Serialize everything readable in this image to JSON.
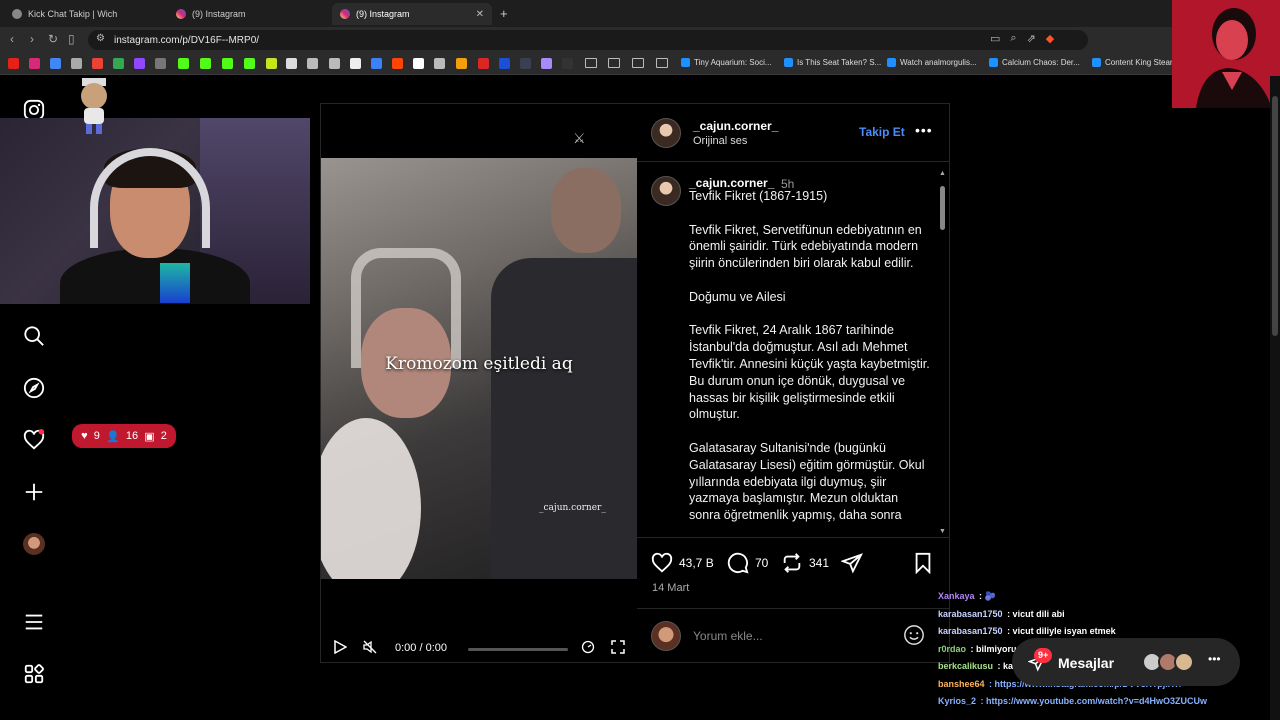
{
  "browser": {
    "tabs": [
      {
        "title": "Kick Chat Takip | Wich"
      },
      {
        "title": "(9) Instagram"
      },
      {
        "title": "(9) Instagram"
      }
    ],
    "url": "instagram.com/p/DV16F--MRP0/",
    "bookmarks": [
      {
        "label": "Tiny Aquarium: Soci..."
      },
      {
        "label": "Is This Seat Taken? S..."
      },
      {
        "label": "Watch analmorgulis..."
      },
      {
        "label": "Calcium Chaos: Der..."
      },
      {
        "label": "Content King Stear"
      }
    ]
  },
  "notifications": {
    "likes": "9",
    "follows": "16",
    "comments": "2"
  },
  "post": {
    "video": {
      "caption": "Kromozom eşitledi aq",
      "watermark": "_cajun.corner_",
      "time": "0:00 / 0:00"
    },
    "author": "_cajun.corner_",
    "audio": "Orijinal ses",
    "follow_label": "Takip Et",
    "comment_author": "_cajun.corner_",
    "comment_age": "5h",
    "paragraphs": [
      "Tevfik Fikret (1867-1915)",
      "Tevfik Fikret, Servetifünun edebiyatının en önemli şairidir. Türk edebiyatında modern şiirin öncülerinden biri olarak kabul edilir.",
      "Doğumu ve Ailesi",
      "Tevfik Fikret, 24 Aralık 1867 tarihinde İstanbul'da doğmuştur. Asıl adı Mehmet Tevfik'tir. Annesini küçük yaşta kaybetmiştir. Bu durum onun içe dönük, duygusal ve hassas bir kişilik geliştirmesinde etkili olmuştur.",
      "Galatasaray Sultanisi'nde (bugünkü Galatasaray Lisesi) eğitim görmüştür. Okul yıllarında edebiyata ilgi duymuş, şiir yazmaya başlamıştır. Mezun olduktan sonra öğretmenlik yapmış, daha sonra"
    ],
    "likes": "43,7 B",
    "comments": "70",
    "reposts": "341",
    "date": "14 Mart",
    "comment_placeholder": "Yorum ekle..."
  },
  "chat": [
    {
      "user": "Xankaya",
      "text": " : 🫐",
      "color": "#b084f5"
    },
    {
      "user": "karabasan1750",
      "text": " : vicut dili abi",
      "color": "#c7d2ff"
    },
    {
      "user": "karabasan1750",
      "text": " : vicut diliyle isyan etmek",
      "color": "#c7d2ff"
    },
    {
      "user": "r0rdao",
      "text": " : bilmiyorum",
      "color": "#8bd17c"
    },
    {
      "user": "berkcalikusu",
      "text": " : kal kırılır yel içinde kalır",
      "color": "#a5e08a"
    },
    {
      "user": "banshee64",
      "text": " : https://www.instagram.com/p/DVV3XYpjlXT/",
      "color": "#ffb35c"
    },
    {
      "user": "Kyrios_2",
      "text": " : https://www.youtube.com/watch?v=d4HwO3ZUCUw",
      "color": "#86b2ff"
    }
  ],
  "messages": {
    "label": "Mesajlar",
    "badge": "9+"
  },
  "colors": {
    "accent": "#4a8df8",
    "notification": "#c0182e",
    "brave": "#fb542b"
  }
}
